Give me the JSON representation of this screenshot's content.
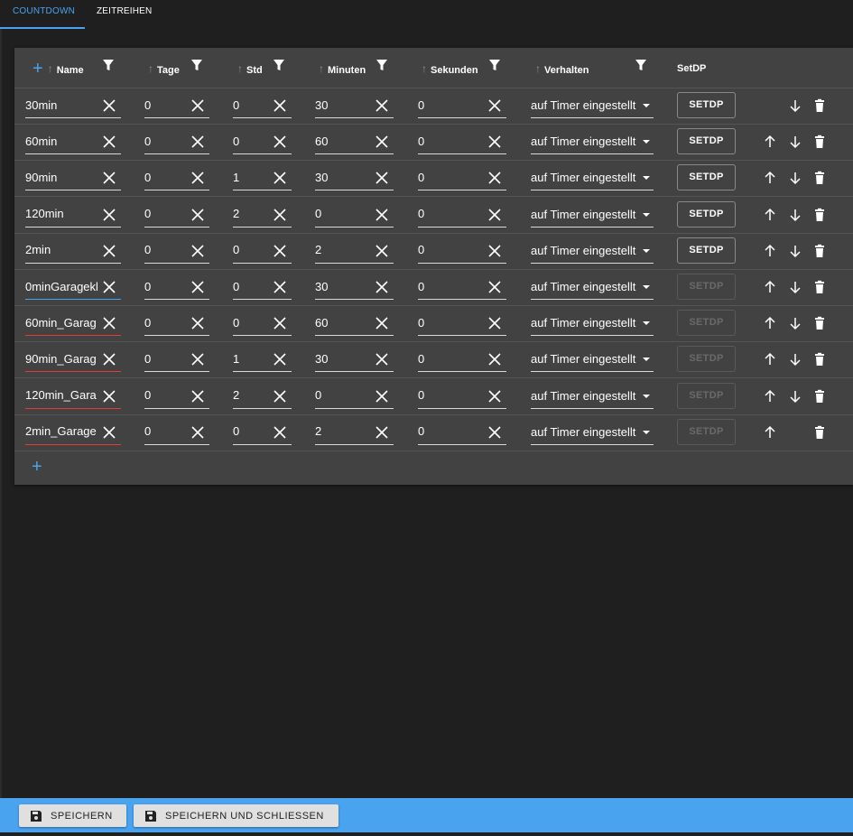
{
  "tabs": [
    {
      "label": "COUNTDOWN",
      "active": true
    },
    {
      "label": "ZEITREIHEN",
      "active": false
    }
  ],
  "table": {
    "headers": {
      "name": "Name",
      "tage": "Tage",
      "std": "Std",
      "minuten": "Minuten",
      "sekunden": "Sekunden",
      "verhalten": "Verhalten",
      "setdp": "SetDP"
    },
    "setdp_label": "SETDP",
    "rows": [
      {
        "name": "30min",
        "tage": "0",
        "std": "0",
        "minuten": "30",
        "sekunden": "0",
        "verhalten": "auf Timer eingestellt"
      },
      {
        "name": "60min",
        "tage": "0",
        "std": "0",
        "minuten": "60",
        "sekunden": "0",
        "verhalten": "auf Timer eingestellt"
      },
      {
        "name": "90min",
        "tage": "0",
        "std": "1",
        "minuten": "30",
        "sekunden": "0",
        "verhalten": "auf Timer eingestellt"
      },
      {
        "name": "120min",
        "tage": "0",
        "std": "2",
        "minuten": "0",
        "sekunden": "0",
        "verhalten": "auf Timer eingestellt"
      },
      {
        "name": "2min",
        "tage": "0",
        "std": "0",
        "minuten": "2",
        "sekunden": "0",
        "verhalten": "auf Timer eingestellt"
      },
      {
        "name": "0minGaragekl",
        "tage": "0",
        "std": "0",
        "minuten": "30",
        "sekunden": "0",
        "verhalten": "auf Timer eingestellt"
      },
      {
        "name": "60min_Garag",
        "tage": "0",
        "std": "0",
        "minuten": "60",
        "sekunden": "0",
        "verhalten": "auf Timer eingestellt"
      },
      {
        "name": "90min_Garag",
        "tage": "0",
        "std": "1",
        "minuten": "30",
        "sekunden": "0",
        "verhalten": "auf Timer eingestellt"
      },
      {
        "name": "120min_Gara",
        "tage": "0",
        "std": "2",
        "minuten": "0",
        "sekunden": "0",
        "verhalten": "auf Timer eingestellt"
      },
      {
        "name": "2min_Garage",
        "tage": "0",
        "std": "0",
        "minuten": "2",
        "sekunden": "0",
        "verhalten": "auf Timer eingestellt"
      }
    ]
  },
  "footer": {
    "save_label": "SPEICHERN",
    "save_close_label": "SPEICHERN UND SCHLIESSEN"
  },
  "colors": {
    "accent": "#4aa3ef",
    "error": "#e53935",
    "panel": "#424242",
    "background": "#1f1f1f"
  }
}
